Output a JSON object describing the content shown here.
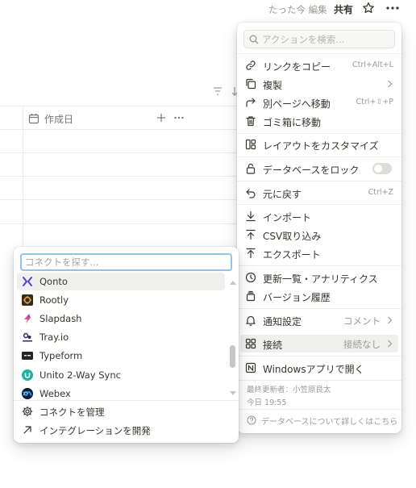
{
  "topbar": {
    "edited": "たった今 編集",
    "share": "共有"
  },
  "database": {
    "column_label": "作成日"
  },
  "action_menu": {
    "search_placeholder": "アクションを検索...",
    "items": [
      {
        "label": "リンクをコピー",
        "shortcut": "Ctrl+Alt+L",
        "icon": "link-icon"
      },
      {
        "label": "複製",
        "icon": "duplicate-icon",
        "submenu": true
      },
      {
        "label": "別ページへ移動",
        "shortcut": "Ctrl+⇧+P",
        "icon": "move-arrow-icon"
      },
      {
        "label": "ゴミ箱に移動",
        "icon": "trash-icon"
      },
      {
        "label": "レイアウトをカスタマイズ",
        "icon": "layout-icon"
      },
      {
        "label": "データベースをロック",
        "icon": "lock-icon",
        "toggle": false
      },
      {
        "label": "元に戻す",
        "shortcut": "Ctrl+Z",
        "icon": "undo-icon"
      },
      {
        "label": "インポート",
        "icon": "import-icon"
      },
      {
        "label": "CSV取り込み",
        "icon": "csv-import-icon"
      },
      {
        "label": "エクスポート",
        "icon": "export-icon"
      },
      {
        "label": "更新一覧・アナリティクス",
        "icon": "updates-icon"
      },
      {
        "label": "バージョン履歴",
        "icon": "history-icon"
      },
      {
        "label": "通知設定",
        "value": "コメント",
        "icon": "bell-icon",
        "submenu": true
      },
      {
        "label": "接続",
        "value": "接続なし",
        "icon": "connections-icon",
        "submenu": true,
        "highlighted": true
      },
      {
        "label": "Windowsアプリで開く",
        "icon": "notion-app-icon"
      }
    ],
    "last_edited_by": "最終更新者：小笠原良太",
    "last_edited_time": "今日 19:55",
    "learn_more": "データベースについて詳しくはこちら"
  },
  "connections_popup": {
    "search_placeholder": "コネクトを探す...",
    "items": [
      {
        "label": "Qonto",
        "icon": "qonto-logo-icon",
        "color": "#5a3fd6"
      },
      {
        "label": "Rootly",
        "icon": "rootly-logo-icon",
        "color": "#6b4a2e"
      },
      {
        "label": "Slapdash",
        "icon": "slapdash-logo-icon",
        "color": "#e84a8c"
      },
      {
        "label": "Tray.io",
        "icon": "tray-logo-icon",
        "color": "#2b2d6e"
      },
      {
        "label": "Typeform",
        "icon": "typeform-logo-icon",
        "color": "#262627"
      },
      {
        "label": "Unito 2-Way Sync",
        "icon": "unito-logo-icon",
        "color": "#1fb3a6"
      },
      {
        "label": "Webex",
        "icon": "webex-logo-icon",
        "color": "#0a64d8"
      }
    ],
    "footer": [
      {
        "label": "コネクトを管理",
        "icon": "gear-icon"
      },
      {
        "label": "インテグレーションを開発",
        "icon": "arrow-up-right-icon"
      }
    ]
  }
}
